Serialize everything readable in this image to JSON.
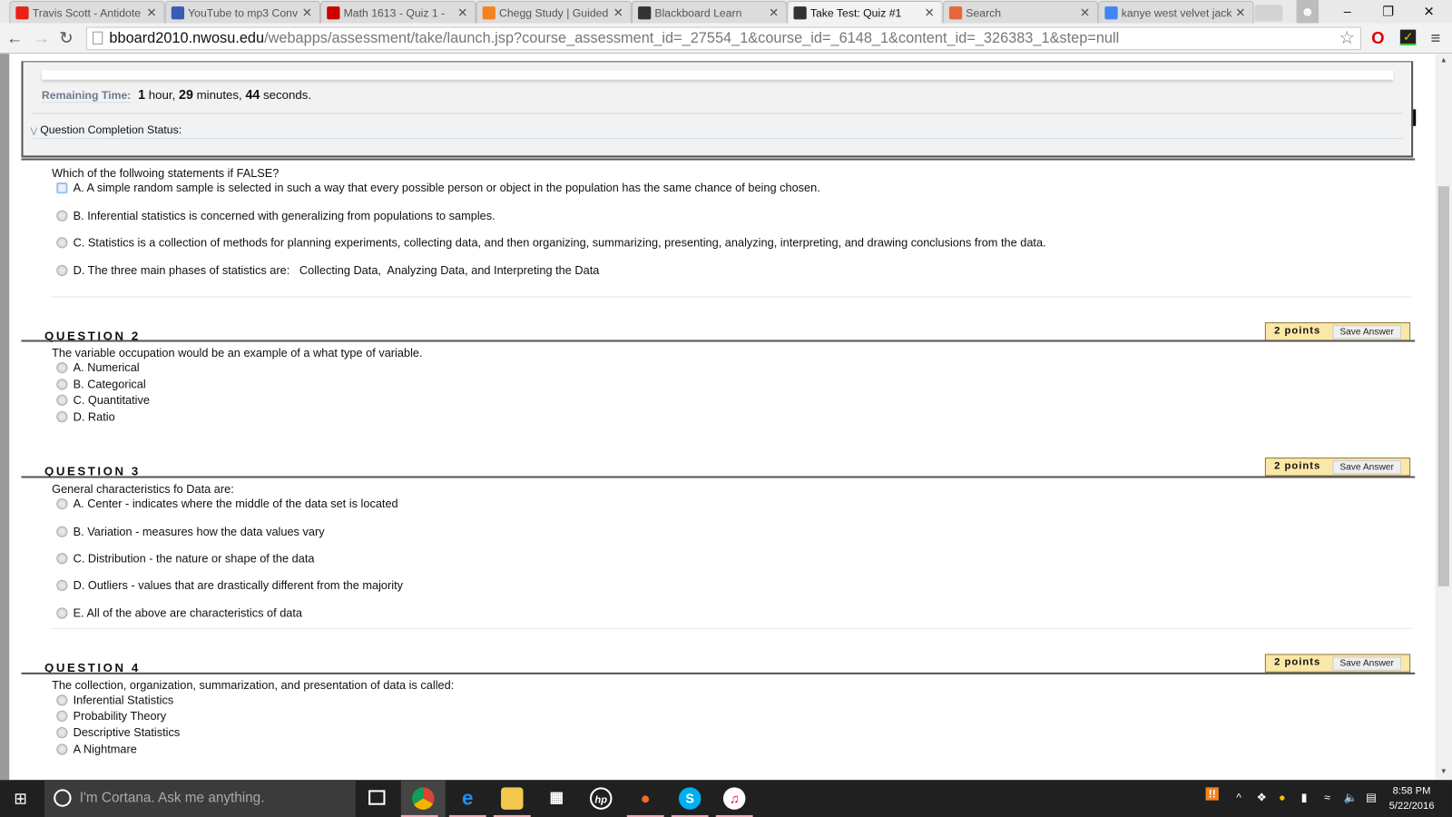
{
  "browser": {
    "tabs": [
      {
        "title": "Travis Scott - Antidote",
        "icon": "youtube-icon",
        "color": "#e62117",
        "active": false
      },
      {
        "title": "YouTube to mp3 Conv",
        "icon": "yt-mp3-icon",
        "color": "#3b5bb5",
        "active": false
      },
      {
        "title": "Math 1613 - Quiz 1 - ",
        "icon": "webassign-icon",
        "color": "#c00",
        "active": false
      },
      {
        "title": "Chegg Study | Guided",
        "icon": "chegg-icon",
        "color": "#f58220",
        "active": false
      },
      {
        "title": "Blackboard Learn",
        "icon": "blackboard-icon",
        "color": "#333",
        "active": false
      },
      {
        "title": "Take Test: Quiz #1",
        "icon": "blackboard-icon",
        "color": "#333",
        "active": true
      },
      {
        "title": "Search",
        "icon": "jt-icon",
        "color": "#e8663c",
        "active": false
      },
      {
        "title": "kanye west velvet jack",
        "icon": "google-icon",
        "color": "#4285f4",
        "active": false
      }
    ],
    "url_host": "bboard2010.nwosu.edu",
    "url_path": "/webapps/assessment/take/launch.jsp?course_assessment_id=_27554_1&course_id=_6148_1&content_id=_326383_1&step=null"
  },
  "timer": {
    "label": "Remaining Time:",
    "hours": "1",
    "hours_unit": "hour,",
    "minutes": "29",
    "minutes_unit": "minutes,",
    "seconds": "44",
    "seconds_unit": "seconds.",
    "completion_status": "Question Completion Status:"
  },
  "questions": [
    {
      "text": "Which of the follwoing statements if FALSE?",
      "options": [
        "A. A simple random sample is selected in such a way that every possible person or object in the population has the same chance of being chosen.",
        "B. Inferential statistics is concerned with generalizing from populations to samples.",
        "C. Statistics is a collection of methods for planning experiments, collecting data, and then organizing, summarizing, presenting, analyzing, interpreting, and drawing conclusions from the data.",
        "D. The three main phases of statistics are:   Collecting Data,  Analyzing Data, and Interpreting the Data"
      ]
    },
    {
      "header": "QUESTION 2",
      "points": "2 points",
      "save": "Save Answer",
      "text": "The variable occupation would be an example of a what type of variable.",
      "options": [
        "A. Numerical",
        "B. Categorical",
        "C. Quantitative",
        "D. Ratio"
      ]
    },
    {
      "header": "QUESTION 3",
      "points": "2 points",
      "save": "Save Answer",
      "text": "General characteristics fo Data are:",
      "options": [
        "A. Center - indicates where the middle of the data set is located",
        "B. Variation - measures how the data values vary",
        "C. Distribution - the nature or shape of the data",
        "D. Outliers - values that are drastically different from the majority",
        "E. All of the above are characteristics of data"
      ]
    },
    {
      "header": "QUESTION 4",
      "points": "2 points",
      "save": "Save Answer",
      "text": "The collection, organization, summarization, and presentation of data is called:",
      "options": [
        "Inferential Statistics",
        "Probability Theory",
        "Descriptive Statistics",
        "A Nightmare"
      ]
    }
  ],
  "taskbar": {
    "search_placeholder": "I'm Cortana. Ask me anything.",
    "time": "8:58 PM",
    "date": "5/22/2016"
  }
}
